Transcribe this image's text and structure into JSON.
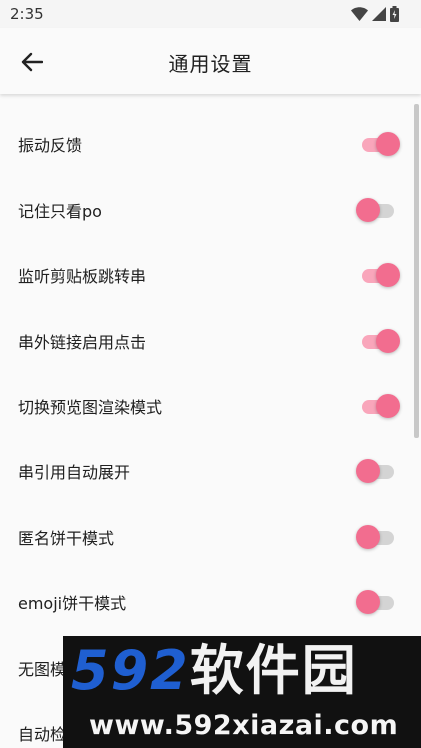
{
  "status_bar": {
    "time": "2:35",
    "icons": [
      "wifi-icon",
      "cell-signal-icon",
      "battery-icon"
    ]
  },
  "header": {
    "title": "通用设置",
    "back_icon": "arrow-left-icon"
  },
  "settings": [
    {
      "label": "振动反馈",
      "on": true
    },
    {
      "label": "记住只看po",
      "on": false
    },
    {
      "label": "监听剪贴板跳转串",
      "on": true
    },
    {
      "label": "串外链接启用点击",
      "on": true
    },
    {
      "label": "切换预览图渲染模式",
      "on": true
    },
    {
      "label": "串引用自动展开",
      "on": false
    },
    {
      "label": "匿名饼干模式",
      "on": false
    },
    {
      "label": "emoji饼干模式",
      "on": false
    },
    {
      "label": "无图模",
      "on": null
    },
    {
      "label": "自动检",
      "on": null
    }
  ],
  "watermark": {
    "logo_number": "592",
    "logo_text": "软件园",
    "url": "www.592xiazai.com"
  },
  "colors": {
    "accent": "#f26d8f",
    "track_on": "#f9a6bb",
    "track_off": "#d4d4d4"
  }
}
